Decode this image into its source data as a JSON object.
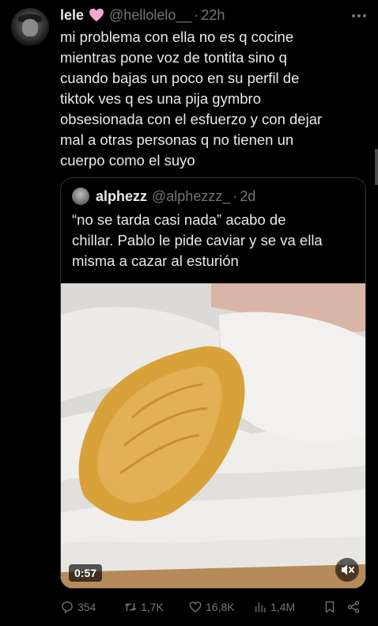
{
  "tweet": {
    "name": "lele",
    "handle": "@hellolelo__",
    "separator": "·",
    "time": "22h",
    "text": "mi problema con ella no es q cocine\nmientras pone voz de tontita sino q\ncuando bajas un poco en su perfil de\ntiktok ves q es una pija gymbro\nobsesionada con el esfuerzo y con dejar\nmal a otras personas q no tienen un\ncuerpo como el suyo",
    "heart_color": "#f4a6d7"
  },
  "quote": {
    "name": "alphezz",
    "handle": "@alphezzz_",
    "separator": "·",
    "time": "2d",
    "text": "“no se tarda casi nada” acabo de\nchillar. Pablo le pide caviar y se va ella\nmisma a cazar al esturión",
    "video_duration": "0:57"
  },
  "actions": {
    "replies": "354",
    "retweets": "1,7K",
    "likes": "16,8K",
    "views": "1,4M"
  },
  "icons": [
    "more-icon",
    "reply-icon",
    "retweet-icon",
    "like-icon",
    "views-icon",
    "bookmark-icon",
    "share-icon",
    "mute-icon",
    "heart-emoji-icon"
  ],
  "colors": {
    "background": "#000000",
    "text": "#e7e9ea",
    "muted": "#71767b",
    "border": "#2f3336"
  }
}
